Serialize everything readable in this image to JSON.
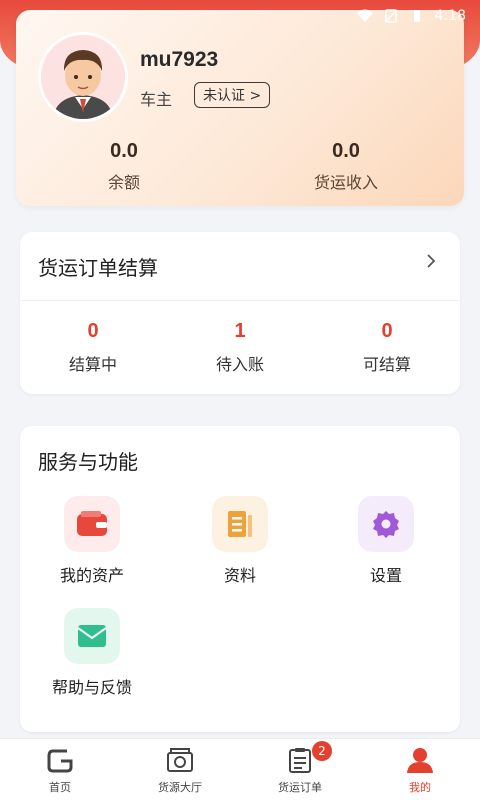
{
  "status_bar": {
    "time": "4:18"
  },
  "profile": {
    "username": "mu7923",
    "role": "车主",
    "verify_label": "未认证 >",
    "stats": [
      {
        "value": "0.0",
        "label": "余额"
      },
      {
        "value": "0.0",
        "label": "货运收入"
      }
    ]
  },
  "settlement": {
    "title": "货运订单结算",
    "items": [
      {
        "value": "0",
        "label": "结算中"
      },
      {
        "value": "1",
        "label": "待入账"
      },
      {
        "value": "0",
        "label": "可结算"
      }
    ]
  },
  "services": {
    "title": "服务与功能",
    "items": [
      {
        "label": "我的资产",
        "icon": "wallet-icon",
        "color": "#e8473c"
      },
      {
        "label": "资料",
        "icon": "document-icon",
        "color": "#f0a23a"
      },
      {
        "label": "设置",
        "icon": "gear-icon",
        "color": "#a05ad8"
      },
      {
        "label": "帮助与反馈",
        "icon": "feedback-icon",
        "color": "#2fbf8f"
      }
    ]
  },
  "tabbar": {
    "tabs": [
      {
        "label": "首页",
        "icon": "home-icon"
      },
      {
        "label": "货源大厅",
        "icon": "cargo-hall-icon"
      },
      {
        "label": "货运订单",
        "icon": "order-icon",
        "badge": "2"
      },
      {
        "label": "我的",
        "icon": "profile-icon",
        "active": true
      }
    ]
  },
  "colors": {
    "accent": "#e3402f"
  }
}
